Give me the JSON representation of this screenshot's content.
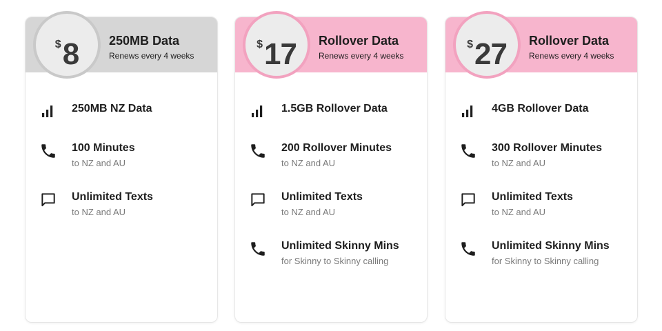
{
  "plans": [
    {
      "currency": "$",
      "price": "8",
      "title": "250MB Data",
      "subtitle": "Renews every 4 weeks",
      "features": [
        {
          "icon": "signal-bars-icon",
          "name": "250MB NZ Data",
          "sub": ""
        },
        {
          "icon": "phone-icon",
          "name": "100 Minutes",
          "sub": "to NZ and AU"
        },
        {
          "icon": "message-icon",
          "name": "Unlimited Texts",
          "sub": "to NZ and AU"
        }
      ]
    },
    {
      "currency": "$",
      "price": "17",
      "title": "Rollover Data",
      "subtitle": "Renews every 4 weeks",
      "features": [
        {
          "icon": "signal-bars-icon",
          "name": "1.5GB Rollover Data",
          "sub": ""
        },
        {
          "icon": "phone-icon",
          "name": "200 Rollover Minutes",
          "sub": "to NZ and AU"
        },
        {
          "icon": "message-icon",
          "name": "Unlimited Texts",
          "sub": "to NZ and AU"
        },
        {
          "icon": "phone-icon",
          "name": "Unlimited Skinny Mins",
          "sub": "for Skinny to Skinny calling"
        }
      ]
    },
    {
      "currency": "$",
      "price": "27",
      "title": "Rollover Data",
      "subtitle": "Renews every 4 weeks",
      "features": [
        {
          "icon": "signal-bars-icon",
          "name": "4GB Rollover Data",
          "sub": ""
        },
        {
          "icon": "phone-icon",
          "name": "300 Rollover Minutes",
          "sub": "to NZ and AU"
        },
        {
          "icon": "message-icon",
          "name": "Unlimited Texts",
          "sub": "to NZ and AU"
        },
        {
          "icon": "phone-icon",
          "name": "Unlimited Skinny Mins",
          "sub": "for Skinny to Skinny calling"
        }
      ]
    }
  ],
  "colors": {
    "header_grey": "#d6d6d6",
    "header_pink": "#f7b5cd",
    "ring_grey": "#c9c9c9",
    "ring_pink": "#f2a2bf",
    "circle_fill": "#ececec",
    "text_dark": "#1e1e1e",
    "text_muted": "#7a7a7a"
  }
}
